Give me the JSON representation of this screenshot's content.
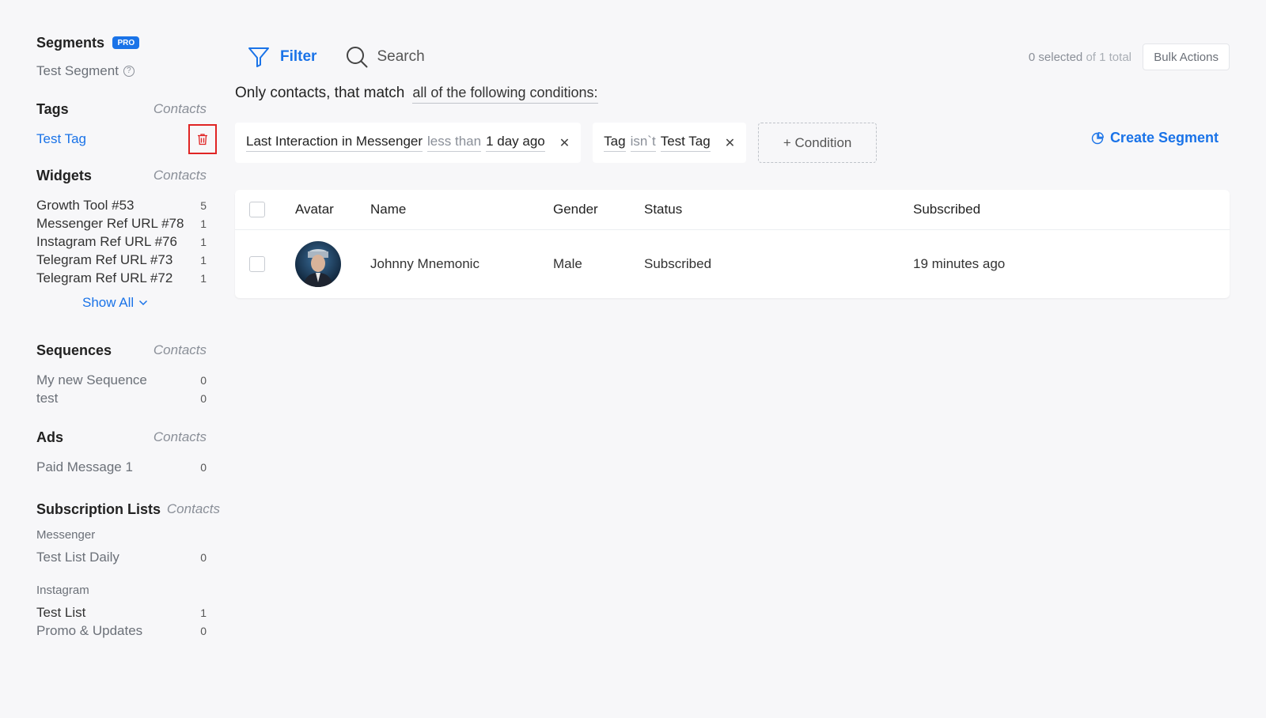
{
  "sidebar": {
    "segments": {
      "title": "Segments",
      "badge": "PRO",
      "items": [
        "Test Segment"
      ]
    },
    "tags": {
      "title": "Tags",
      "contacts_label": "Contacts",
      "items": [
        {
          "label": "Test Tag"
        }
      ]
    },
    "widgets": {
      "title": "Widgets",
      "contacts_label": "Contacts",
      "items": [
        {
          "label": "Growth Tool #53",
          "count": "5"
        },
        {
          "label": "Messenger Ref URL #78",
          "count": "1"
        },
        {
          "label": "Instagram Ref URL #76",
          "count": "1"
        },
        {
          "label": "Telegram Ref URL #73",
          "count": "1"
        },
        {
          "label": "Telegram Ref URL #72",
          "count": "1"
        }
      ],
      "show_all": "Show All"
    },
    "sequences": {
      "title": "Sequences",
      "contacts_label": "Contacts",
      "items": [
        {
          "label": "My new Sequence",
          "count": "0"
        },
        {
          "label": "test",
          "count": "0"
        }
      ]
    },
    "ads": {
      "title": "Ads",
      "contacts_label": "Contacts",
      "items": [
        {
          "label": "Paid Message 1",
          "count": "0"
        }
      ]
    },
    "subscription_lists": {
      "title": "Subscription Lists",
      "contacts_label": "Contacts",
      "groups": [
        {
          "name": "Messenger",
          "items": [
            {
              "label": "Test List Daily",
              "count": "0"
            }
          ]
        },
        {
          "name": "Instagram",
          "items": [
            {
              "label": "Test List",
              "count": "1"
            },
            {
              "label": "Promo & Updates",
              "count": "0"
            }
          ]
        }
      ]
    }
  },
  "toolbar": {
    "filter_label": "Filter",
    "search_label": "Search",
    "selected_count": "0 selected",
    "of_total": "of 1 total",
    "bulk_actions": "Bulk Actions"
  },
  "match": {
    "prefix": "Only contacts, that match",
    "mode": "all of the following conditions:"
  },
  "conditions": [
    {
      "field": "Last Interaction in Messenger",
      "operator": "less than",
      "value": "1 day ago"
    },
    {
      "field": "Tag",
      "operator": "isn`t",
      "value": "Test Tag"
    }
  ],
  "add_condition": "+ Condition",
  "create_segment": "Create Segment",
  "table": {
    "headers": {
      "avatar": "Avatar",
      "name": "Name",
      "gender": "Gender",
      "status": "Status",
      "subscribed": "Subscribed"
    },
    "rows": [
      {
        "name": "Johnny Mnemonic",
        "gender": "Male",
        "status": "Subscribed",
        "subscribed": "19 minutes ago"
      }
    ]
  },
  "colors": {
    "accent": "#1a73e8",
    "danger": "#e02424",
    "background": "#f7f7f9"
  }
}
